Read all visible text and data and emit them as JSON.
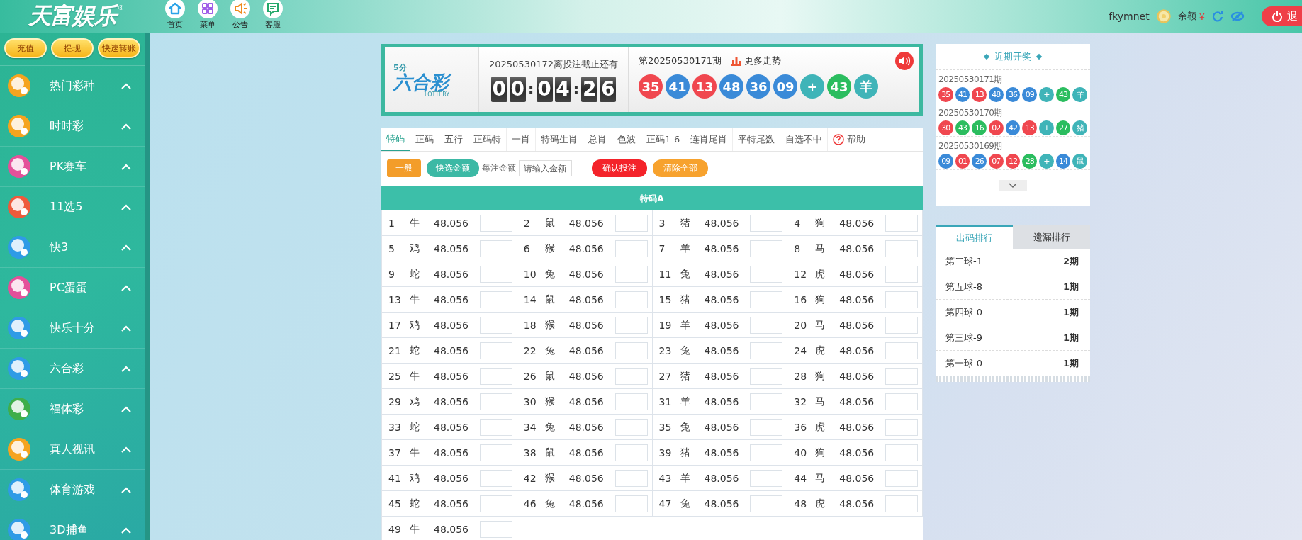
{
  "header": {
    "logo": "天富娱乐",
    "logo_mark": "®",
    "nav": [
      {
        "label": "首页",
        "kind": "home"
      },
      {
        "label": "菜单",
        "kind": "grid"
      },
      {
        "label": "公告",
        "kind": "speaker"
      },
      {
        "label": "客服",
        "kind": "chat"
      }
    ],
    "username": "fkymnet",
    "balance_label": "余额",
    "currency": "¥",
    "logout": "退"
  },
  "sidebar": {
    "buttons": [
      "充值",
      "提现",
      "快速转账"
    ],
    "items": [
      {
        "label": "热门彩种",
        "color": "#f5a41f"
      },
      {
        "label": "时时彩",
        "color": "#f5a41f"
      },
      {
        "label": "PK赛车",
        "color": "#e4509a"
      },
      {
        "label": "11选5",
        "color": "#ee5a3c"
      },
      {
        "label": "快3",
        "color": "#2f9be6"
      },
      {
        "label": "PC蛋蛋",
        "color": "#e4509a"
      },
      {
        "label": "快乐十分",
        "color": "#2f9be6"
      },
      {
        "label": "六合彩",
        "color": "#2f9be6"
      },
      {
        "label": "福体彩",
        "color": "#3fae4a"
      },
      {
        "label": "真人视讯",
        "color": "#f5a41f"
      },
      {
        "label": "体育游戏",
        "color": "#2f9be6"
      },
      {
        "label": "3D捕鱼",
        "color": "#2f9be6"
      }
    ]
  },
  "banner": {
    "logo_sub": "5分",
    "logo_name": "六合彩",
    "logo_en": "LOTTERY",
    "countdown_label": "20250530172离投注截止还有",
    "countdown": [
      "0",
      "0",
      ":",
      "0",
      "4",
      ":",
      "2",
      "6"
    ],
    "last_issue": "第20250530171期",
    "trend_link": "更多走势",
    "balls": [
      {
        "text": "35",
        "color": "#f0474f"
      },
      {
        "text": "41",
        "color": "#3a8ad8"
      },
      {
        "text": "13",
        "color": "#f0474f"
      },
      {
        "text": "48",
        "color": "#3a8ad8"
      },
      {
        "text": "36",
        "color": "#3a8ad8"
      },
      {
        "text": "09",
        "color": "#3a8ad8"
      },
      {
        "text": "+",
        "color": "#3fb4b8"
      },
      {
        "text": "43",
        "color": "#2bbd5f"
      },
      {
        "text": "羊",
        "color": "#3fb4b8"
      }
    ]
  },
  "bet": {
    "tabs": [
      {
        "label": "特码",
        "selected": true,
        "kind": "play"
      },
      {
        "label": "正码",
        "selected": false,
        "kind": "play"
      },
      {
        "label": "五行",
        "selected": false,
        "kind": "play"
      },
      {
        "label": "正码特",
        "selected": false,
        "kind": "play"
      },
      {
        "label": "一肖",
        "selected": false,
        "kind": "play"
      },
      {
        "label": "特码生肖",
        "selected": false,
        "kind": "play"
      },
      {
        "label": "总肖",
        "selected": false,
        "kind": "play"
      },
      {
        "label": "色波",
        "selected": false,
        "kind": "play"
      },
      {
        "label": "正码1-6",
        "selected": false,
        "kind": "play"
      },
      {
        "label": "连肖尾肖",
        "selected": false,
        "kind": "play"
      },
      {
        "label": "平特尾数",
        "selected": false,
        "kind": "play"
      },
      {
        "label": "自选不中",
        "selected": false,
        "kind": "play"
      },
      {
        "label": "帮助",
        "selected": false,
        "kind": "help"
      }
    ],
    "mode_button": "一般",
    "quick_button": "快选金额",
    "amount_label": "每注金额",
    "amount_placeholder": "请输入金额",
    "confirm_button": "确认投注",
    "clear_button": "清除全部",
    "table_title": "特码A",
    "cells": [
      {
        "num": "1",
        "zodiac": "牛",
        "odds": "48.056"
      },
      {
        "num": "2",
        "zodiac": "鼠",
        "odds": "48.056"
      },
      {
        "num": "3",
        "zodiac": "猪",
        "odds": "48.056"
      },
      {
        "num": "4",
        "zodiac": "狗",
        "odds": "48.056"
      },
      {
        "num": "5",
        "zodiac": "鸡",
        "odds": "48.056"
      },
      {
        "num": "6",
        "zodiac": "猴",
        "odds": "48.056"
      },
      {
        "num": "7",
        "zodiac": "羊",
        "odds": "48.056"
      },
      {
        "num": "8",
        "zodiac": "马",
        "odds": "48.056"
      },
      {
        "num": "9",
        "zodiac": "蛇",
        "odds": "48.056"
      },
      {
        "num": "10",
        "zodiac": "兔",
        "odds": "48.056"
      },
      {
        "num": "11",
        "zodiac": "兔",
        "odds": "48.056"
      },
      {
        "num": "12",
        "zodiac": "虎",
        "odds": "48.056"
      },
      {
        "num": "13",
        "zodiac": "牛",
        "odds": "48.056"
      },
      {
        "num": "14",
        "zodiac": "鼠",
        "odds": "48.056"
      },
      {
        "num": "15",
        "zodiac": "猪",
        "odds": "48.056"
      },
      {
        "num": "16",
        "zodiac": "狗",
        "odds": "48.056"
      },
      {
        "num": "17",
        "zodiac": "鸡",
        "odds": "48.056"
      },
      {
        "num": "18",
        "zodiac": "猴",
        "odds": "48.056"
      },
      {
        "num": "19",
        "zodiac": "羊",
        "odds": "48.056"
      },
      {
        "num": "20",
        "zodiac": "马",
        "odds": "48.056"
      },
      {
        "num": "21",
        "zodiac": "蛇",
        "odds": "48.056"
      },
      {
        "num": "22",
        "zodiac": "兔",
        "odds": "48.056"
      },
      {
        "num": "23",
        "zodiac": "兔",
        "odds": "48.056"
      },
      {
        "num": "24",
        "zodiac": "虎",
        "odds": "48.056"
      },
      {
        "num": "25",
        "zodiac": "牛",
        "odds": "48.056"
      },
      {
        "num": "26",
        "zodiac": "鼠",
        "odds": "48.056"
      },
      {
        "num": "27",
        "zodiac": "猪",
        "odds": "48.056"
      },
      {
        "num": "28",
        "zodiac": "狗",
        "odds": "48.056"
      },
      {
        "num": "29",
        "zodiac": "鸡",
        "odds": "48.056"
      },
      {
        "num": "30",
        "zodiac": "猴",
        "odds": "48.056"
      },
      {
        "num": "31",
        "zodiac": "羊",
        "odds": "48.056"
      },
      {
        "num": "32",
        "zodiac": "马",
        "odds": "48.056"
      },
      {
        "num": "33",
        "zodiac": "蛇",
        "odds": "48.056"
      },
      {
        "num": "34",
        "zodiac": "兔",
        "odds": "48.056"
      },
      {
        "num": "35",
        "zodiac": "兔",
        "odds": "48.056"
      },
      {
        "num": "36",
        "zodiac": "虎",
        "odds": "48.056"
      },
      {
        "num": "37",
        "zodiac": "牛",
        "odds": "48.056"
      },
      {
        "num": "38",
        "zodiac": "鼠",
        "odds": "48.056"
      },
      {
        "num": "39",
        "zodiac": "猪",
        "odds": "48.056"
      },
      {
        "num": "40",
        "zodiac": "狗",
        "odds": "48.056"
      },
      {
        "num": "41",
        "zodiac": "鸡",
        "odds": "48.056"
      },
      {
        "num": "42",
        "zodiac": "猴",
        "odds": "48.056"
      },
      {
        "num": "43",
        "zodiac": "羊",
        "odds": "48.056"
      },
      {
        "num": "44",
        "zodiac": "马",
        "odds": "48.056"
      },
      {
        "num": "45",
        "zodiac": "蛇",
        "odds": "48.056"
      },
      {
        "num": "46",
        "zodiac": "兔",
        "odds": "48.056"
      },
      {
        "num": "47",
        "zodiac": "兔",
        "odds": "48.056"
      },
      {
        "num": "48",
        "zodiac": "虎",
        "odds": "48.056"
      },
      {
        "num": "49",
        "zodiac": "牛",
        "odds": "48.056"
      }
    ]
  },
  "recent": {
    "title": "近期开奖",
    "draws": [
      {
        "issue": "20250530171期",
        "balls": [
          {
            "text": "35",
            "color": "#f0474f"
          },
          {
            "text": "41",
            "color": "#3a8ad8"
          },
          {
            "text": "13",
            "color": "#f0474f"
          },
          {
            "text": "48",
            "color": "#3a8ad8"
          },
          {
            "text": "36",
            "color": "#3a8ad8"
          },
          {
            "text": "09",
            "color": "#3a8ad8"
          },
          {
            "text": "+",
            "color": "#3fb4b8"
          },
          {
            "text": "43",
            "color": "#2bbd5f"
          },
          {
            "text": "羊",
            "color": "#3fb4b8"
          }
        ]
      },
      {
        "issue": "20250530170期",
        "balls": [
          {
            "text": "30",
            "color": "#f0474f"
          },
          {
            "text": "43",
            "color": "#2bbd5f"
          },
          {
            "text": "16",
            "color": "#2bbd5f"
          },
          {
            "text": "02",
            "color": "#f0474f"
          },
          {
            "text": "42",
            "color": "#3a8ad8"
          },
          {
            "text": "13",
            "color": "#f0474f"
          },
          {
            "text": "+",
            "color": "#3fb4b8"
          },
          {
            "text": "27",
            "color": "#2bbd5f"
          },
          {
            "text": "猪",
            "color": "#3fb4b8"
          }
        ]
      },
      {
        "issue": "20250530169期",
        "balls": [
          {
            "text": "09",
            "color": "#3a8ad8"
          },
          {
            "text": "01",
            "color": "#f0474f"
          },
          {
            "text": "26",
            "color": "#3a8ad8"
          },
          {
            "text": "07",
            "color": "#f0474f"
          },
          {
            "text": "12",
            "color": "#f0474f"
          },
          {
            "text": "28",
            "color": "#2bbd5f"
          },
          {
            "text": "+",
            "color": "#3fb4b8"
          },
          {
            "text": "14",
            "color": "#3a8ad8"
          },
          {
            "text": "鼠",
            "color": "#3fb4b8"
          }
        ]
      }
    ]
  },
  "ranking": {
    "tabs": [
      {
        "label": "出码排行",
        "selected": true
      },
      {
        "label": "遗漏排行",
        "selected": false
      }
    ],
    "rows": [
      {
        "name": "第二球-1",
        "count": "2期"
      },
      {
        "name": "第五球-8",
        "count": "1期"
      },
      {
        "name": "第四球-0",
        "count": "1期"
      },
      {
        "name": "第三球-9",
        "count": "1期"
      },
      {
        "name": "第一球-0",
        "count": "1期"
      }
    ]
  }
}
